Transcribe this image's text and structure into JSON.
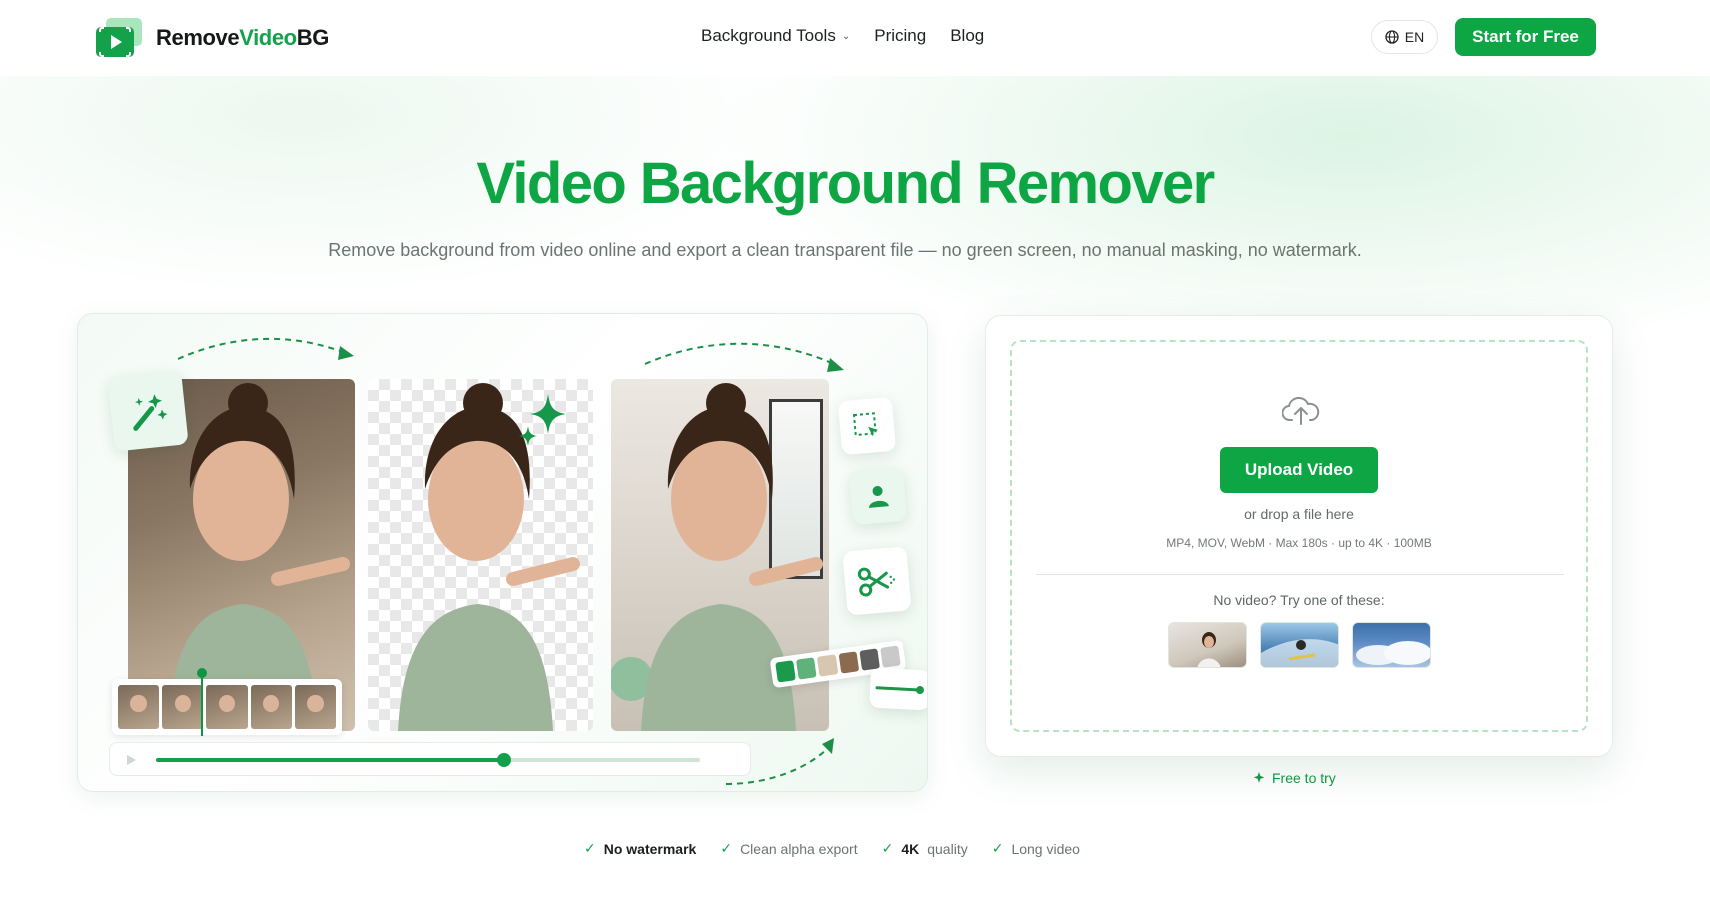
{
  "brand": {
    "name_part1": "Remove",
    "name_part2": "Video",
    "name_part3": "BG"
  },
  "nav": {
    "items": [
      {
        "label": "Background Tools",
        "has_dropdown": true
      },
      {
        "label": "Pricing"
      },
      {
        "label": "Blog"
      }
    ],
    "language": "EN",
    "cta": "Start for Free"
  },
  "hero": {
    "title": "Video Background Remover",
    "subtitle": "Remove background from video online and export a clean transparent file — no green screen, no manual masking, no watermark."
  },
  "showcase": {
    "playback_progress": 0.639
  },
  "upload": {
    "button_label": "Upload Video",
    "drop_hint": "or drop a file here",
    "specs": "MP4, MOV, WebM · Max 180s · up to 4K · 100MB",
    "samples_prompt": "No video? Try one of these:",
    "samples": [
      {
        "name": "sample-woman-office"
      },
      {
        "name": "sample-surfer"
      },
      {
        "name": "sample-clouds"
      }
    ]
  },
  "free_note": "Free to try",
  "features": [
    {
      "bold": "No watermark",
      "rest": ""
    },
    {
      "bold": "",
      "rest": "Clean alpha export"
    },
    {
      "bold": "4K",
      "rest": "quality"
    },
    {
      "bold": "",
      "rest": "Long video"
    }
  ],
  "colors": {
    "accent": "#0ea645",
    "accent_dark": "#0e9642",
    "text": "#1f2421",
    "muted": "#6b7470"
  }
}
